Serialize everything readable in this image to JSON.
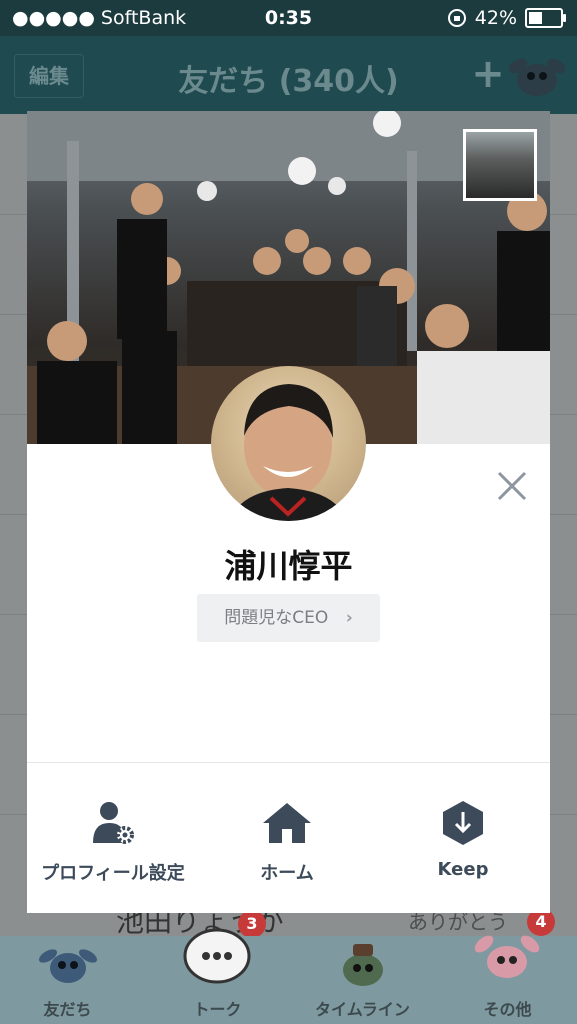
{
  "status_bar": {
    "carrier": "●●●●● SoftBank",
    "time": "0:35",
    "battery": "42%",
    "battery_level": 0.42
  },
  "header": {
    "edit_label": "編集",
    "title": "友だち (340人)",
    "add_label": "+"
  },
  "background": {
    "peek_name": "池田りょうが",
    "peek_message": "ありがとう",
    "badges": [
      "3",
      "4"
    ]
  },
  "tabbar": {
    "tabs": [
      {
        "label": "友だち",
        "icon": "stitch-icon"
      },
      {
        "label": "トーク",
        "icon": "chat-bubble-icon"
      },
      {
        "label": "タイムライン",
        "icon": "scrump-doll-icon"
      },
      {
        "label": "その他",
        "icon": "angel-icon"
      }
    ]
  },
  "profile": {
    "name": "浦川惇平",
    "status_message": "問題児なCEO",
    "actions": [
      {
        "label": "プロフィール設定",
        "icon": "profile-settings-icon"
      },
      {
        "label": "ホーム",
        "icon": "home-icon"
      },
      {
        "label": "Keep",
        "icon": "keep-icon"
      }
    ]
  },
  "colors": {
    "accent": "#3c4a5a",
    "status_bar_bg": "#1c3b3f",
    "header_bg": "#1f4a50",
    "status_pill_bg": "#eef0f2",
    "badge": "#c73a3a"
  }
}
